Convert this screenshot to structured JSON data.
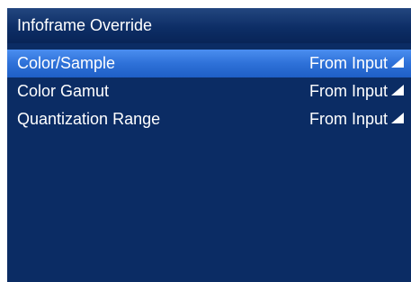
{
  "title": "Infoframe Override",
  "items": [
    {
      "label": "Color/Sample",
      "value": "From Input",
      "selected": true
    },
    {
      "label": "Color Gamut",
      "value": "From Input",
      "selected": false
    },
    {
      "label": "Quantization Range",
      "value": "From Input",
      "selected": false
    }
  ],
  "dropdown_icon": "triangle-dropdown-icon",
  "colors": {
    "panel_bg": "#0b2c64",
    "selected_bg": "#2e71d8",
    "text": "#ffffff"
  }
}
